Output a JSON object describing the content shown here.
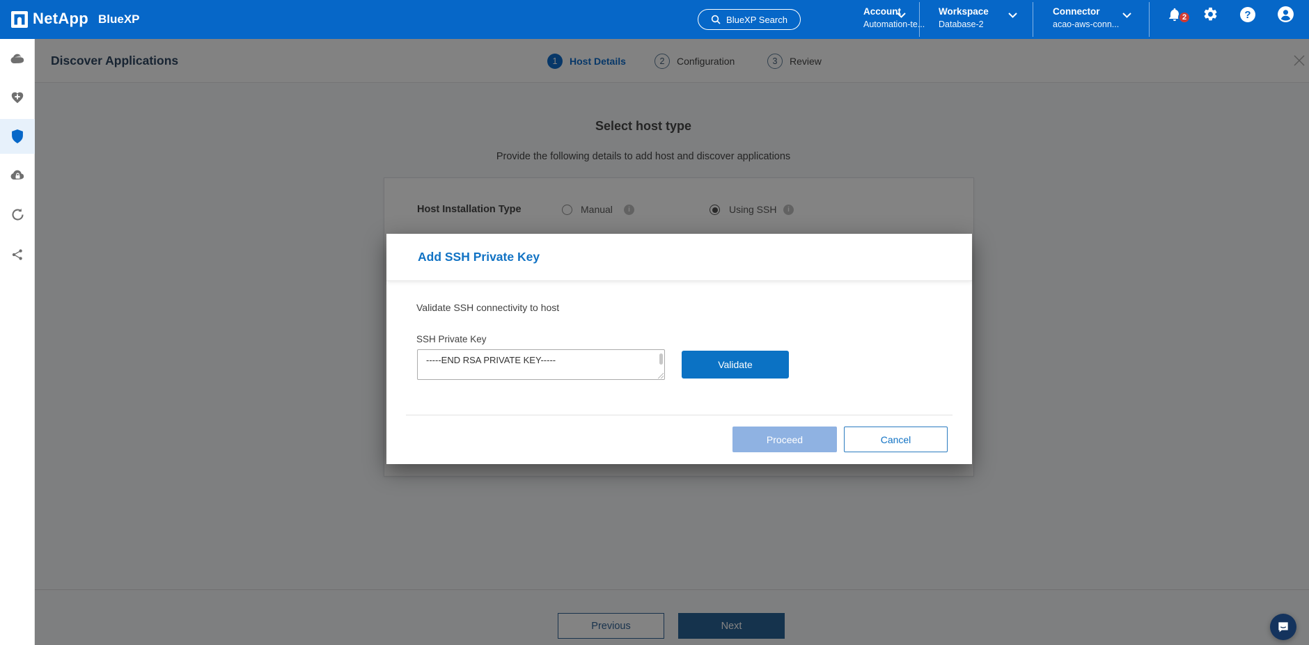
{
  "colors": {
    "header_blue": "#0667C8",
    "accent_blue": "#1273C4",
    "active_step_blue": "#0667C8",
    "disabled_button_blue": "#8FB2E2",
    "next_button_navy": "#235E92",
    "badge_red": "#D13B33"
  },
  "header": {
    "brand": "NetApp",
    "product": "BlueXP",
    "search_label": "BlueXP Search",
    "account_label": "Account",
    "account_value": "Automation-te...",
    "workspace_label": "Workspace",
    "workspace_value": "Database-2",
    "connector_label": "Connector",
    "connector_value": "acao-aws-conn...",
    "notification_count": "2",
    "help_glyph": "?"
  },
  "sidebar": {
    "icons": [
      "cloud-storage-icon",
      "health-add-icon",
      "protection-shield-icon",
      "cloud-lock-icon",
      "sync-icon",
      "share-nodes-icon"
    ],
    "active_icon": "protection-shield-icon"
  },
  "toolbar": {
    "title": "Discover Applications",
    "steps": [
      {
        "number": "1",
        "label": "Host Details",
        "active": true
      },
      {
        "number": "2",
        "label": "Configuration",
        "active": false
      },
      {
        "number": "3",
        "label": "Review",
        "active": false
      }
    ]
  },
  "content": {
    "heading": "Select host type",
    "subheading": "Provide the following details to add host and discover applications",
    "installation_type_label": "Host Installation Type",
    "info_glyph": "i",
    "options": [
      {
        "label": "Manual",
        "selected": false
      },
      {
        "label": "Using SSH",
        "selected": true
      }
    ]
  },
  "modal": {
    "title": "Add SSH Private Key",
    "description": "Validate SSH connectivity to host",
    "field_label": "SSH Private Key",
    "field_value": "-----END RSA PRIVATE KEY-----",
    "validate_label": "Validate",
    "proceed_label": "Proceed",
    "cancel_label": "Cancel"
  },
  "footer": {
    "previous_label": "Previous",
    "next_label": "Next"
  }
}
